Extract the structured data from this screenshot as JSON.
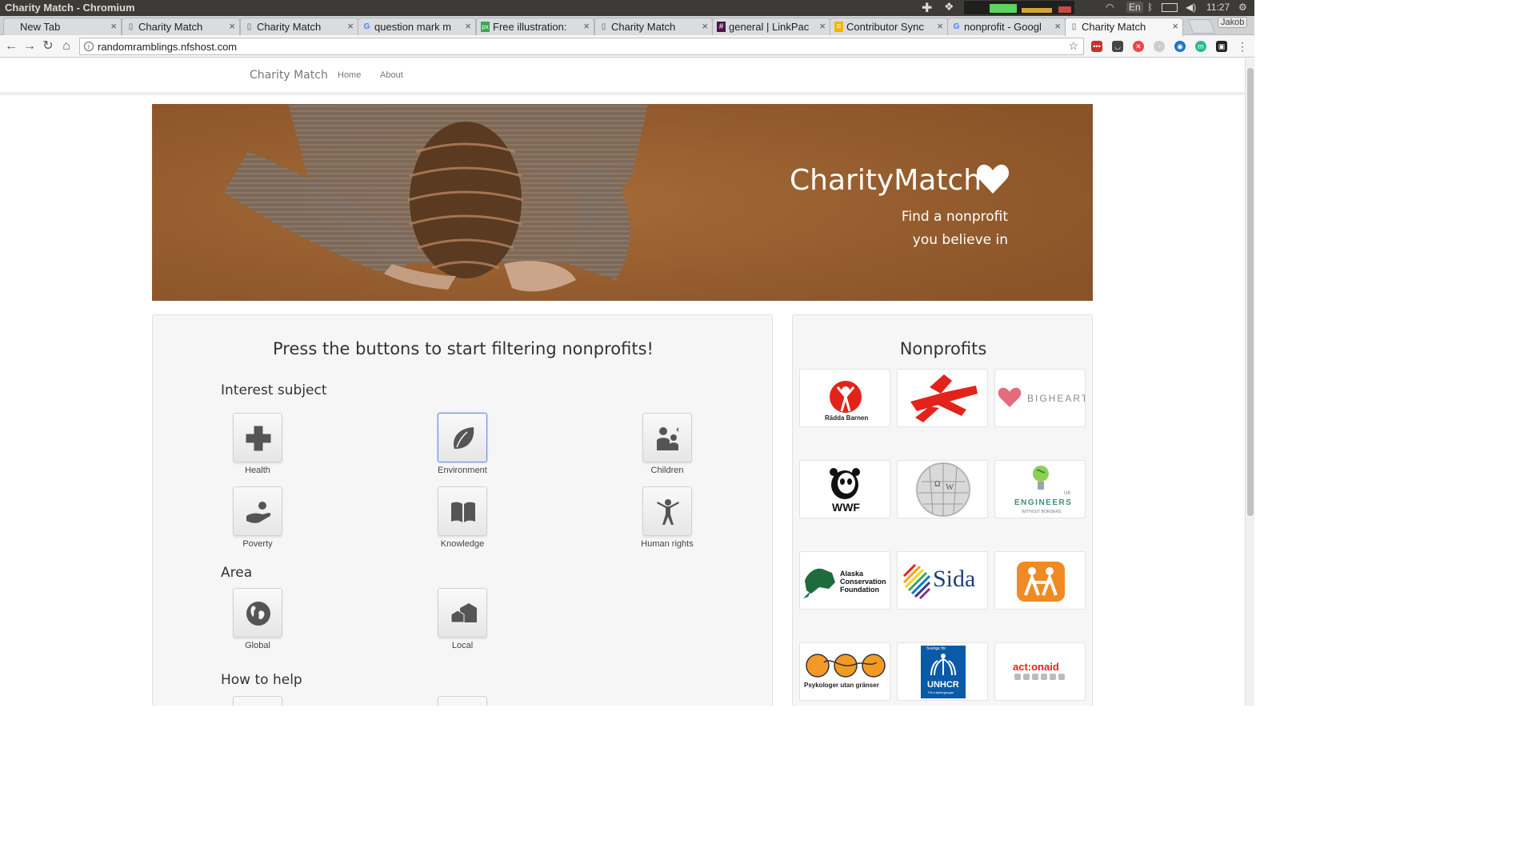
{
  "os": {
    "window_title": "Charity Match - Chromium",
    "lang": "En",
    "clock": "11:27"
  },
  "browser": {
    "tabs": [
      {
        "title": "New Tab",
        "favicon": "blank"
      },
      {
        "title": "Charity Match",
        "favicon": "page-icon"
      },
      {
        "title": "Charity Match",
        "favicon": "page-icon"
      },
      {
        "title": "question mark m",
        "favicon": "google-icon"
      },
      {
        "title": "Free illustration:",
        "favicon": "pixabay-icon"
      },
      {
        "title": "Charity Match",
        "favicon": "page-icon"
      },
      {
        "title": "general | LinkPac",
        "favicon": "slack-icon"
      },
      {
        "title": "Contributor Sync",
        "favicon": "sheet-icon"
      },
      {
        "title": "nonprofit - Googl",
        "favicon": "google-icon"
      },
      {
        "title": "Charity Match",
        "favicon": "page-icon"
      }
    ],
    "active_tab": 9,
    "profile": "Jakob",
    "url": "randomramblings.nfshost.com"
  },
  "site": {
    "brand": "Charity Match",
    "nav": [
      "Home",
      "About"
    ],
    "hero": {
      "title": "CharityMatch",
      "subtitle_line1": "Find a nonprofit",
      "subtitle_line2": "you believe in"
    },
    "filter": {
      "heading": "Press the buttons to start filtering nonprofits!",
      "interest_title": "Interest subject",
      "interests": [
        {
          "label": "Health",
          "icon": "health-cross-icon",
          "selected": false
        },
        {
          "label": "Environment",
          "icon": "leaf-icon",
          "selected": true
        },
        {
          "label": "Children",
          "icon": "children-icon",
          "selected": false
        },
        {
          "label": "Poverty",
          "icon": "hand-coin-icon",
          "selected": false
        },
        {
          "label": "Knowledge",
          "icon": "book-icon",
          "selected": false
        },
        {
          "label": "Human rights",
          "icon": "person-icon",
          "selected": false
        }
      ],
      "area_title": "Area",
      "areas": [
        {
          "label": "Global",
          "icon": "globe-icon"
        },
        {
          "label": "Local",
          "icon": "houses-icon"
        }
      ],
      "help_title": "How to help"
    },
    "nonprofits": {
      "heading": "Nonprofits",
      "logos": [
        {
          "name": "radda-barnen",
          "text": "Rädda Barnen"
        },
        {
          "name": "msf",
          "text": ""
        },
        {
          "name": "bigheart",
          "text": "BIGHEART"
        },
        {
          "name": "wwf",
          "text": "WWF"
        },
        {
          "name": "wikipedia",
          "text": ""
        },
        {
          "name": "engineers-without-borders",
          "text": "ENGINEERS",
          "sub": "WITHOUT BORDERS",
          "tag": "UK"
        },
        {
          "name": "alaska-conservation-foundation",
          "text": "Alaska Conservation Foundation"
        },
        {
          "name": "sida",
          "text": "Sida"
        },
        {
          "name": "sos-childrens-villages",
          "text": ""
        },
        {
          "name": "psykologer-utan-granser",
          "text": "Psykologer utan gränser"
        },
        {
          "name": "unhcr",
          "text": "UNHCR",
          "top": "Sverige för",
          "sub": "FN:s flyktingorgan"
        },
        {
          "name": "actionaid",
          "text": "act:onaid"
        }
      ]
    }
  },
  "colors": {
    "hero": "#9a6232",
    "accent": "#6d8ed6",
    "icon": "#555555"
  }
}
